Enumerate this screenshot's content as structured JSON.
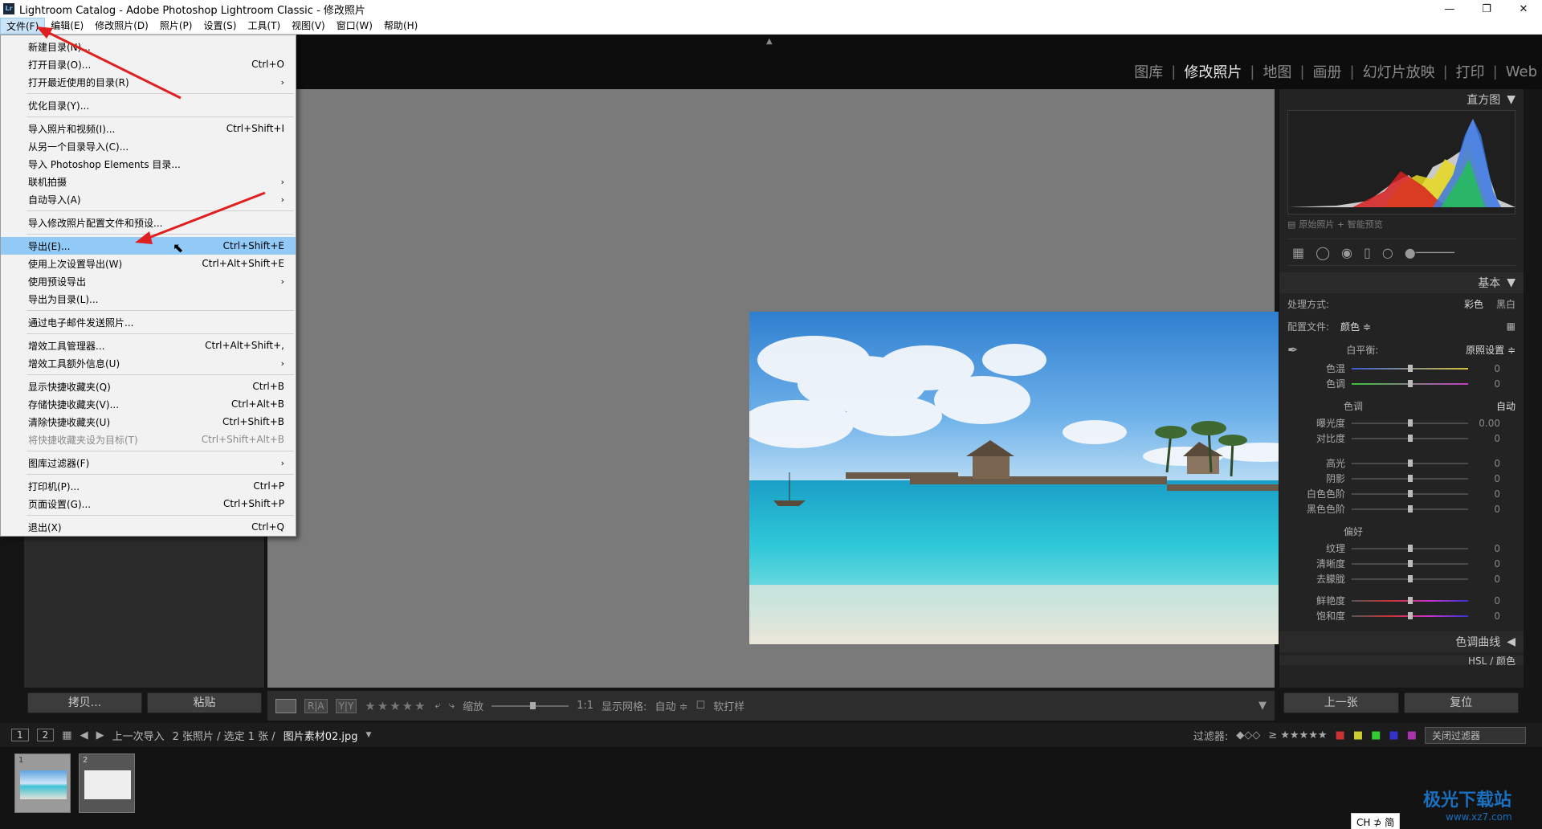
{
  "window": {
    "title": "Lightroom Catalog - Adobe Photoshop Lightroom Classic - 修改照片",
    "logo": "Lr",
    "controls": [
      "minimize-icon",
      "restore-icon",
      "close-icon"
    ]
  },
  "menubar": [
    "文件(F)",
    "编辑(E)",
    "修改照片(D)",
    "照片(P)",
    "设置(S)",
    "工具(T)",
    "视图(V)",
    "窗口(W)",
    "帮助(H)"
  ],
  "modules": {
    "items": [
      "图库",
      "修改照片",
      "地图",
      "画册",
      "幻灯片放映",
      "打印",
      "Web"
    ],
    "active": "修改照片"
  },
  "file_menu": {
    "groups": [
      [
        {
          "label": "新建目录(N)...",
          "shortcut": ""
        },
        {
          "label": "打开目录(O)...",
          "shortcut": "Ctrl+O"
        },
        {
          "label": "打开最近使用的目录(R)",
          "shortcut": "",
          "submenu": true
        }
      ],
      [
        {
          "label": "优化目录(Y)...",
          "shortcut": ""
        }
      ],
      [
        {
          "label": "导入照片和视频(I)...",
          "shortcut": "Ctrl+Shift+I"
        },
        {
          "label": "从另一个目录导入(C)...",
          "shortcut": ""
        },
        {
          "label": "导入 Photoshop Elements 目录...",
          "shortcut": ""
        },
        {
          "label": "联机拍摄",
          "shortcut": "",
          "submenu": true
        },
        {
          "label": "自动导入(A)",
          "shortcut": "",
          "submenu": true
        }
      ],
      [
        {
          "label": "导入修改照片配置文件和预设...",
          "shortcut": ""
        }
      ],
      [
        {
          "label": "导出(E)...",
          "shortcut": "Ctrl+Shift+E",
          "highlighted": true
        },
        {
          "label": "使用上次设置导出(W)",
          "shortcut": "Ctrl+Alt+Shift+E"
        },
        {
          "label": "使用预设导出",
          "shortcut": "",
          "submenu": true
        },
        {
          "label": "导出为目录(L)...",
          "shortcut": ""
        }
      ],
      [
        {
          "label": "通过电子邮件发送照片...",
          "shortcut": ""
        }
      ],
      [
        {
          "label": "增效工具管理器...",
          "shortcut": "Ctrl+Alt+Shift+,"
        },
        {
          "label": "增效工具额外信息(U)",
          "shortcut": "",
          "submenu": true
        }
      ],
      [
        {
          "label": "显示快捷收藏夹(Q)",
          "shortcut": "Ctrl+B"
        },
        {
          "label": "存储快捷收藏夹(V)...",
          "shortcut": "Ctrl+Alt+B"
        },
        {
          "label": "清除快捷收藏夹(U)",
          "shortcut": "Ctrl+Shift+B"
        },
        {
          "label": "将快捷收藏夹设为目标(T)",
          "shortcut": "Ctrl+Shift+Alt+B",
          "disabled": true
        }
      ],
      [
        {
          "label": "图库过滤器(F)",
          "shortcut": "",
          "submenu": true
        }
      ],
      [
        {
          "label": "打印机(P)...",
          "shortcut": "Ctrl+P"
        },
        {
          "label": "页面设置(G)...",
          "shortcut": "Ctrl+Shift+P"
        }
      ],
      [
        {
          "label": "退出(X)",
          "shortcut": "Ctrl+Q"
        }
      ]
    ]
  },
  "left_panel": {
    "copy": "拷贝...",
    "paste": "粘贴"
  },
  "toolbar": {
    "zoom_label": "缩放",
    "zoom_value": "1:1",
    "grid_label": "显示网格:",
    "grid_value": "自动 ≑",
    "softproof": "软打样"
  },
  "right_panel": {
    "histogram_title": "直方图",
    "histogram_note": "原始照片 + 智能预览",
    "basic_title": "基本",
    "treatment_label": "处理方式:",
    "treatment_color": "彩色",
    "treatment_bw": "黑白",
    "profile_label": "配置文件:",
    "profile_value": "颜色 ≑",
    "wb_label": "白平衡:",
    "wb_value": "原照设置 ≑",
    "wb_sliders": [
      {
        "label": "色温",
        "value": "0"
      },
      {
        "label": "色调",
        "value": "0"
      }
    ],
    "tone_title": "色调",
    "tone_auto": "自动",
    "tone_sliders": [
      {
        "label": "曝光度",
        "value": "0.00"
      },
      {
        "label": "对比度",
        "value": "0"
      }
    ],
    "light_sliders": [
      {
        "label": "高光",
        "value": "0"
      },
      {
        "label": "阴影",
        "value": "0"
      },
      {
        "label": "白色色阶",
        "value": "0"
      },
      {
        "label": "黑色色阶",
        "value": "0"
      }
    ],
    "presence_title": "偏好",
    "presence_sliders": [
      {
        "label": "纹理",
        "value": "0"
      },
      {
        "label": "清晰度",
        "value": "0"
      },
      {
        "label": "去朦胧",
        "value": "0"
      }
    ],
    "color_sliders": [
      {
        "label": "鲜艳度",
        "value": "0"
      },
      {
        "label": "饱和度",
        "value": "0"
      }
    ],
    "tone_curve_title": "色调曲线",
    "hsl_title": "HSL / 颜色",
    "prev_button": "上一张",
    "reset_button": "复位"
  },
  "filmbar": {
    "page1": "1",
    "page2": "2",
    "source": "上一次导入",
    "counts": "2 张照片 / 选定 1 张 /",
    "filename": "图片素材02.jpg",
    "filter_label": "过滤器:",
    "filter_select": "关闭过滤器"
  },
  "thumbnails": [
    {
      "index": "1",
      "selected": true
    },
    {
      "index": "2",
      "selected": false
    }
  ],
  "ime": "CH ⊅ 简",
  "watermark": {
    "title": "极光下载站",
    "url": "www.xz7.com"
  }
}
